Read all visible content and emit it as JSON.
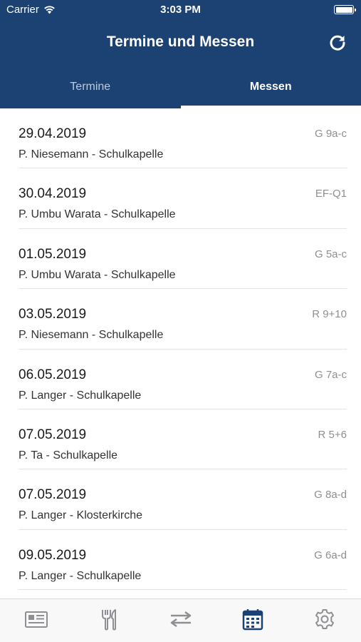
{
  "status_bar": {
    "carrier": "Carrier",
    "time": "3:03 PM"
  },
  "header": {
    "title": "Termine und Messen",
    "refresh_icon": "refresh-icon"
  },
  "tabs": [
    {
      "label": "Termine",
      "active": false
    },
    {
      "label": "Messen",
      "active": true
    }
  ],
  "entries": [
    {
      "date": "29.04.2019",
      "place": "P. Niesemann - Schulkapelle",
      "group": "G 9a-c"
    },
    {
      "date": "30.04.2019",
      "place": "P. Umbu Warata - Schulkapelle",
      "group": "EF-Q1"
    },
    {
      "date": "01.05.2019",
      "place": "P. Umbu Warata - Schulkapelle",
      "group": "G 5a-c"
    },
    {
      "date": "03.05.2019",
      "place": "P. Niesemann - Schulkapelle",
      "group": "R 9+10"
    },
    {
      "date": "06.05.2019",
      "place": "P. Langer - Schulkapelle",
      "group": "G 7a-c"
    },
    {
      "date": "07.05.2019",
      "place": "P. Ta - Schulkapelle",
      "group": "R 5+6"
    },
    {
      "date": "07.05.2019",
      "place": "P. Langer - Klosterkirche",
      "group": "G 8a-d"
    },
    {
      "date": "09.05.2019",
      "place": "P. Langer - Schulkapelle",
      "group": "G 6a-d"
    }
  ],
  "tab_bar": [
    {
      "icon": "newspaper-icon",
      "active": false
    },
    {
      "icon": "fork-knife-icon",
      "active": false
    },
    {
      "icon": "swap-arrows-icon",
      "active": false
    },
    {
      "icon": "calendar-icon",
      "active": true
    },
    {
      "icon": "gear-icon",
      "active": false
    }
  ],
  "colors": {
    "header": "#1c4274",
    "tab_active_icon": "#1c4274",
    "tab_inactive_icon": "#8e8e93"
  }
}
